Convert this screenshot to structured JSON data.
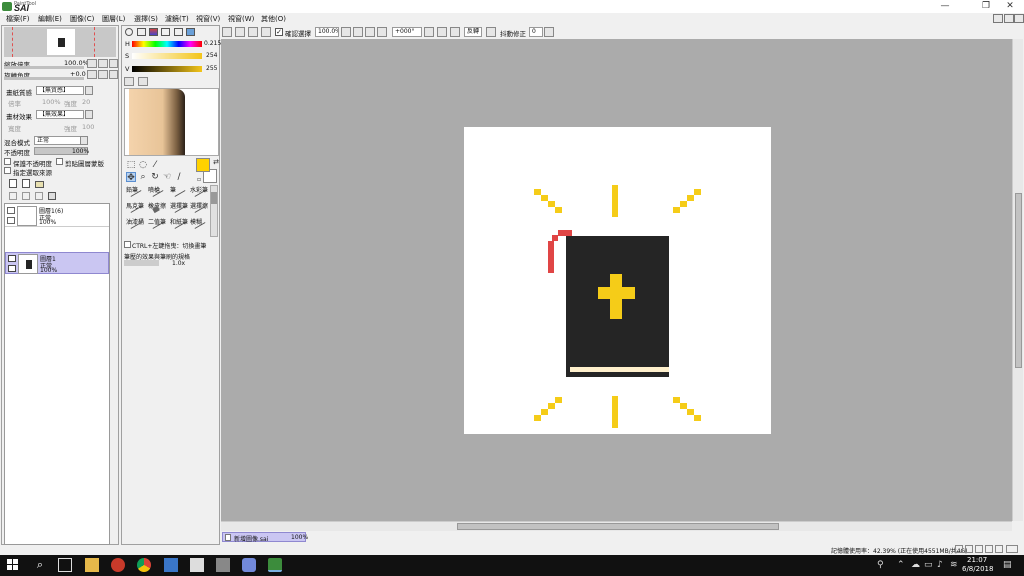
{
  "app": {
    "logo_small": "PaintTool",
    "logo_big": "SAI",
    "window_controls": {
      "minimize": "—",
      "restore": "❐",
      "close": "✕"
    }
  },
  "menu": [
    "檔案(F)",
    "編輯(E)",
    "圖像(C)",
    "圖層(L)",
    "選擇(S)",
    "濾鏡(T)",
    "視窗(V)",
    "視窗(W)",
    "其他(O)"
  ],
  "navigator": {
    "zoom_label": "縮放倍率",
    "zoom_value": "100.0%",
    "angle_label": "旋轉角度",
    "angle_value": "+0.0"
  },
  "layer_props": {
    "effect_label": "畫紙質感",
    "effect_value": "【無質感】",
    "effect_sub1": "倍率",
    "effect_sub1_val": "100%",
    "effect_sub2": "強度",
    "effect_sub2_val": "20",
    "material_label": "畫材效果",
    "material_value": "【無效果】",
    "material_sub1": "寬度",
    "material_sub2": "強度",
    "material_sub2_val": "100",
    "blend_label": "混合模式",
    "blend_value": "正常",
    "opacity_label": "不透明度",
    "opacity_value": "100%",
    "opt1": "保護不透明度",
    "opt2": "剪貼圖層蒙版",
    "opt3": "指定選取來源"
  },
  "layers": [
    {
      "name": "圖層1(6)",
      "mode": "正常",
      "opacity": "100%",
      "selected": false
    },
    {
      "name": "圖層1",
      "mode": "正常",
      "opacity": "100%",
      "selected": true
    }
  ],
  "color": {
    "h_label": "H",
    "h_value": "0.215",
    "s_label": "S",
    "s_value": "254",
    "v_label": "V",
    "v_value": "255",
    "primary": "#ffd200",
    "secondary": "#ffffff",
    "slider_gold": "#f3c51a"
  },
  "brushes": [
    "鉛筆",
    "噴槍",
    "筆",
    "水彩筆",
    "馬克筆",
    "橡皮擦",
    "選擇筆",
    "選擇擦",
    "油漆桶",
    "二值筆",
    "和紙筆",
    "模糊",
    "橡皮擦2",
    "線條"
  ],
  "brush_note": "CTRL+左鍵拖曳：切換畫筆",
  "brush_note2": "筆壓的效果與筆刷的規格",
  "brush_size": "1.0x",
  "toolbar": {
    "stabilizer_check": "確認選擇",
    "zoom": "100.0%",
    "angle": "+000°",
    "flip": "反轉",
    "stabilizer_label": "抖動修正",
    "stabilizer_value": "0"
  },
  "document_tab": {
    "name": "新增圖像.sai",
    "zoom": "100%"
  },
  "status": "記憶體使用率：42.39% (正在使用4551MB/共4G)",
  "clock": {
    "time": "21:07",
    "date": "6/8/2018"
  },
  "canvas_colors": {
    "book": "#252525",
    "cross": "#f5cc18",
    "ray": "#f5cc18",
    "page": "#fff0cc",
    "ribbon": "#e04545"
  }
}
